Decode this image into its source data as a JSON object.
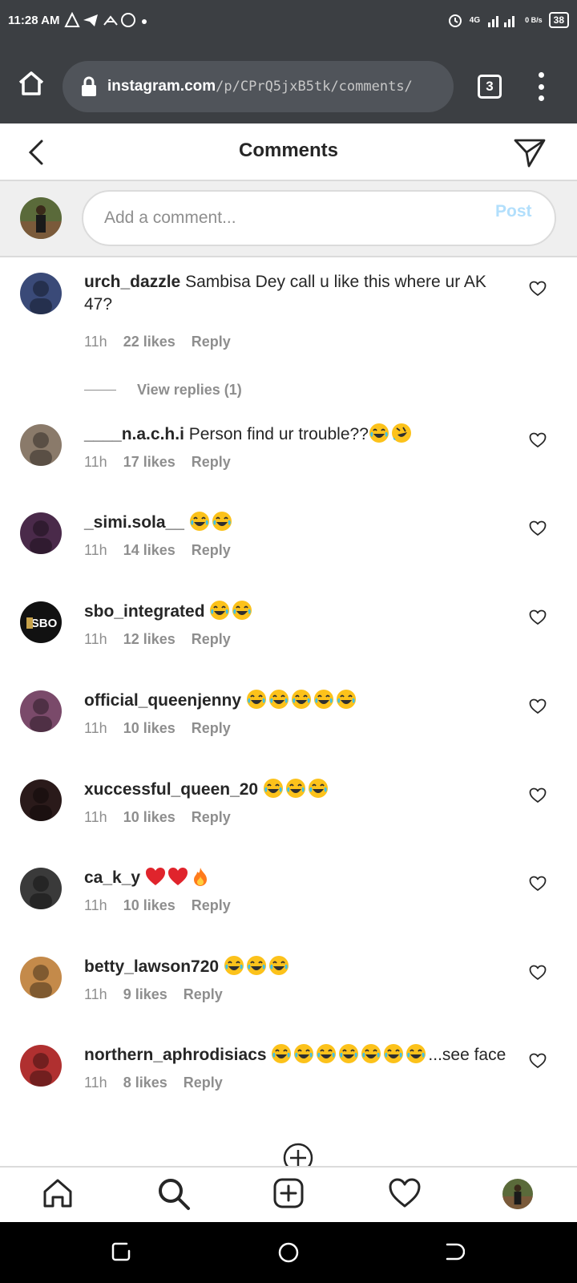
{
  "status_bar": {
    "time": "11:28 AM",
    "network": "4G",
    "speed": "0 B/s",
    "battery": "38"
  },
  "browser": {
    "url_host": "instagram.com",
    "url_path": "/p/CPrQ5jxB5tk/comments/",
    "tab_count": "3"
  },
  "header": {
    "title": "Comments"
  },
  "composer": {
    "placeholder": "Add a comment...",
    "post_label": "Post"
  },
  "comments": [
    {
      "username": "urch_dazzle",
      "text": "Sambisa Dey call u like this where ur AK 47?",
      "emoji": [],
      "time": "11h",
      "likes": "22 likes",
      "reply": "Reply",
      "avatar_color": "#3a4a78"
    },
    {
      "username": "____n.a.c.h.i",
      "text": "Person find ur trouble??",
      "emoji": [
        "laugh",
        "rofl"
      ],
      "time": "11h",
      "likes": "17 likes",
      "reply": "Reply",
      "avatar_color": "#8a7a6a"
    },
    {
      "username": "_simi.sola__",
      "text": "",
      "emoji": [
        "laugh",
        "laugh"
      ],
      "time": "11h",
      "likes": "14 likes",
      "reply": "Reply",
      "avatar_color": "#4a2a4a"
    },
    {
      "username": "sbo_integrated",
      "text": "",
      "emoji": [
        "laugh",
        "laugh"
      ],
      "time": "11h",
      "likes": "12 likes",
      "reply": "Reply",
      "avatar_color": "#111111",
      "avatar_label": "SBO"
    },
    {
      "username": "official_queenjenny",
      "text": "",
      "emoji": [
        "laugh",
        "laugh",
        "laugh",
        "laugh",
        "laugh"
      ],
      "time": "11h",
      "likes": "10 likes",
      "reply": "Reply",
      "avatar_color": "#7a4a6a"
    },
    {
      "username": "xuccessful_queen_20",
      "text": "",
      "emoji": [
        "laugh",
        "laugh",
        "laugh"
      ],
      "time": "11h",
      "likes": "10 likes",
      "reply": "Reply",
      "avatar_color": "#2a1a1a"
    },
    {
      "username": "ca_k_y",
      "text": "",
      "emoji": [
        "heart",
        "heart",
        "fire"
      ],
      "time": "11h",
      "likes": "10 likes",
      "reply": "Reply",
      "avatar_color": "#3a3a3a"
    },
    {
      "username": "betty_lawson720",
      "text": "",
      "emoji": [
        "laugh",
        "laugh",
        "laugh"
      ],
      "time": "11h",
      "likes": "9 likes",
      "reply": "Reply",
      "avatar_color": "#c48a4a"
    },
    {
      "username": "northern_aphrodisiacs",
      "text": "...see face",
      "emoji": [
        "laugh",
        "laugh",
        "laugh",
        "laugh",
        "laugh",
        "laugh",
        "laugh"
      ],
      "time": "11h",
      "likes": "8 likes",
      "reply": "Reply",
      "avatar_color": "#b03030"
    }
  ],
  "view_replies": "View replies (1)"
}
